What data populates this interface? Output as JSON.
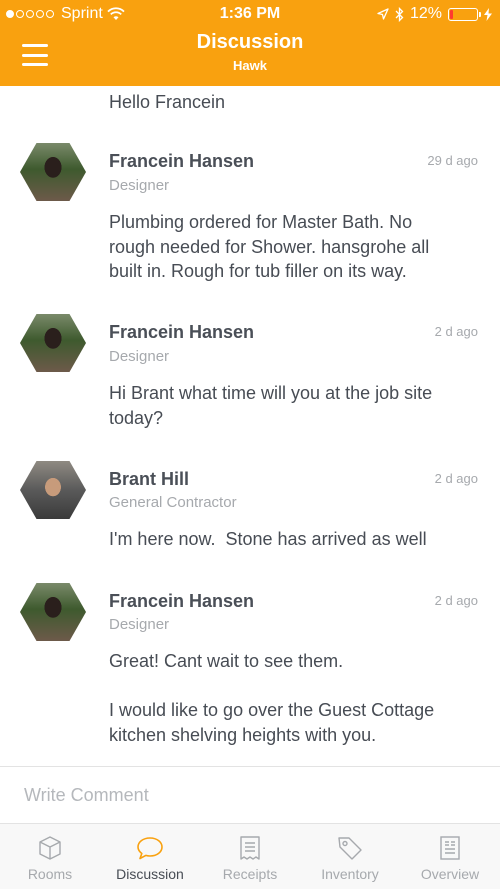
{
  "status_bar": {
    "carrier": "Sprint",
    "time": "1:36 PM",
    "battery_percent": "12%",
    "battery_level": 0.12,
    "signal_bars_filled": 1,
    "signal_bars_total": 5,
    "battery_color": "#ff3b30"
  },
  "header": {
    "title": "Discussion",
    "subtitle": "Hawk",
    "background_color": "#f9a10f",
    "menu_icon": "hamburger-menu-icon"
  },
  "feed": {
    "previous_message_tail": "Hello Francein",
    "posts": [
      {
        "author": "Francein Hansen",
        "role": "Designer",
        "time_ago": "29 d ago",
        "message": "Plumbing ordered for Master Bath. No rough needed for Shower. hansgrohe all built in. Rough for tub filler on its way.",
        "message_lines": [
          "Plumbing ordered for Master Bath. No",
          "rough needed for Shower. hansgrohe all",
          "built in. Rough for tub filler on its way."
        ]
      },
      {
        "author": "Francein Hansen",
        "role": "Designer",
        "time_ago": "2 d ago",
        "message_lines": [
          "Hi Brant what time will you at the job site",
          "today?"
        ]
      },
      {
        "author": "Brant Hill",
        "role": "General Contractor",
        "time_ago": "2 d ago",
        "message_lines": [
          "I'm here now.  Stone has arrived as well"
        ]
      },
      {
        "author": "Francein Hansen",
        "role": "Designer",
        "time_ago": "2 d ago",
        "message_lines": [
          "Great! Cant wait to see them.",
          "",
          "I would like to go over the Guest Cottage",
          "kitchen shelving heights with you."
        ]
      }
    ]
  },
  "comment": {
    "placeholder": "Write Comment",
    "value": ""
  },
  "tabbar": {
    "active_color": "#f9a10f",
    "inactive_color": "#a6a9ad",
    "tabs": [
      {
        "label": "Rooms",
        "icon": "cube-icon",
        "active": false
      },
      {
        "label": "Discussion",
        "icon": "chat-bubble-icon",
        "active": true
      },
      {
        "label": "Receipts",
        "icon": "receipt-icon",
        "active": false
      },
      {
        "label": "Inventory",
        "icon": "tag-icon",
        "active": false
      },
      {
        "label": "Overview",
        "icon": "document-icon",
        "active": false
      }
    ]
  }
}
